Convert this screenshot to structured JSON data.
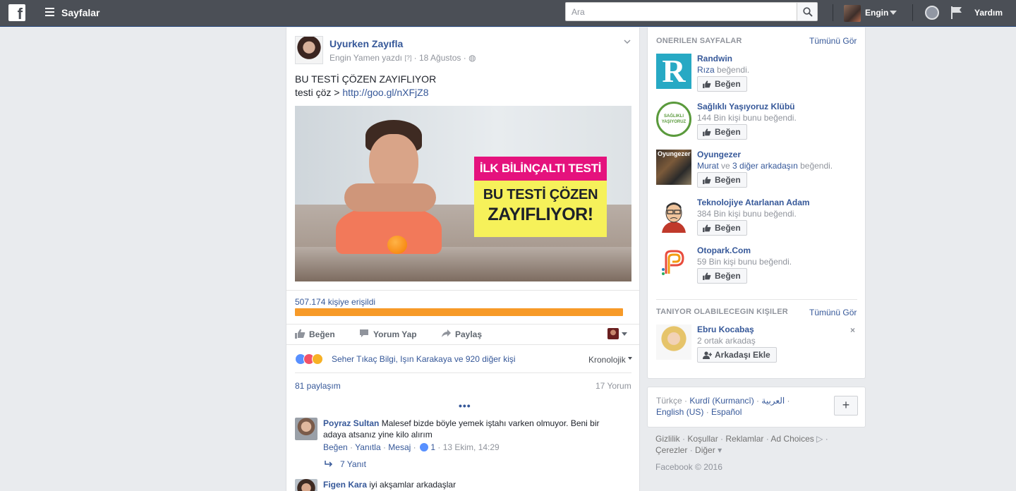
{
  "topbar": {
    "logo": "f",
    "pages_label": "Sayfalar",
    "search_placeholder": "Ara",
    "user_name": "Engin",
    "help_label": "Yardım"
  },
  "post": {
    "page_name": "Uyurken Zayıfla",
    "author_line": "Engin Yamen yazdı",
    "author_q": "[?]",
    "date": "18 Ağustos",
    "text_line1": "BU TESTİ ÇÖZEN ZAYIFLIYOR",
    "text_line2_prefix": "testi çöz > ",
    "link": "http://goo.gl/nXFjZ8",
    "image_badge_top": "İLK BİLİNÇALTI TESTİ",
    "image_badge_line1": "BU TESTİ ÇÖZEN",
    "image_badge_line2": "ZAYIFLIYOR!",
    "reach_text": "507.174 kişiye erişildi",
    "reach_fraction": 1.0,
    "actions": {
      "like": "Beğen",
      "comment": "Yorum Yap",
      "share": "Paylaş"
    },
    "reactions_text": "Seher Tıkaç Bilgi, Işın Karakaya ve 920 diğer kişi",
    "sort_label": "Kronolojik",
    "shares_text": "81 paylaşım",
    "comments_count_text": "17 Yorum",
    "more_dots": "•••",
    "comments": [
      {
        "author": "Poyraz Sultan",
        "text": "Malesef bizde böyle yemek iştahı varken olmuyor. Beni bir adaya atsanız yine kilo alırım",
        "like": "Beğen",
        "reply": "Yanıtla",
        "message": "Mesaj",
        "likes": "1",
        "time": "13 Ekim, 14:29",
        "replies": "7 Yanıt"
      },
      {
        "author": "Figen Kara",
        "text": "iyi akşamlar arkadaşlar"
      }
    ]
  },
  "sidebar": {
    "suggested_title": "ONERILEN SAYFALAR",
    "see_all": "Tümünü Gör",
    "like_button": "Beğen",
    "pages": [
      {
        "name": "Randwin",
        "sub_link": "Rıza",
        "sub_text": " beğendi."
      },
      {
        "name": "Sağlıklı Yaşıyoruz Klübü",
        "sub_link": "",
        "sub_text": "144 Bin kişi bunu beğendi."
      },
      {
        "name": "Oyungezer",
        "sub_link": "Murat",
        "sub_mid": " ve ",
        "sub_link2": "3 diğer arkadaşın",
        "sub_text": " beğendi."
      },
      {
        "name": "Teknolojiye Atarlanan Adam",
        "sub_link": "",
        "sub_text": "384 Bin kişi bunu beğendi."
      },
      {
        "name": "Otopark.Com",
        "sub_link": "",
        "sub_text": "59 Bin kişi bunu beğendi."
      }
    ],
    "thumb_texts": {
      "randwin": "R",
      "saglikli": "SAĞLIKLI YAŞIYORUZ",
      "oyungezer": "Oyungezer"
    },
    "pymk_title": "TANIYOR OLABILECEGIN KIŞILER",
    "pymk_see_all": "Tümünü Gör",
    "pymk_name": "Ebru Kocabaş",
    "pymk_sub": "2 ortak arkadaş",
    "add_friend": "Arkadaşı Ekle",
    "close": "×"
  },
  "languages": {
    "current": "Türkçe",
    "items": [
      "Kurdî (Kurmancî)",
      "العربية",
      "English (US)",
      "Español"
    ],
    "sep": " · ",
    "plus": "+"
  },
  "footer": {
    "links1": [
      "Gizlilik",
      "Koşullar",
      "Reklamlar",
      "Ad Choices"
    ],
    "links2": [
      "Çerezler",
      "Diğer"
    ],
    "copyright": "Facebook © 2016"
  },
  "colors": {
    "topbar": "#4b4f56",
    "link": "#365899",
    "reach_bar": "#f79a28",
    "badge_pink": "#e5127d",
    "badge_yellow": "#f6f15a"
  }
}
